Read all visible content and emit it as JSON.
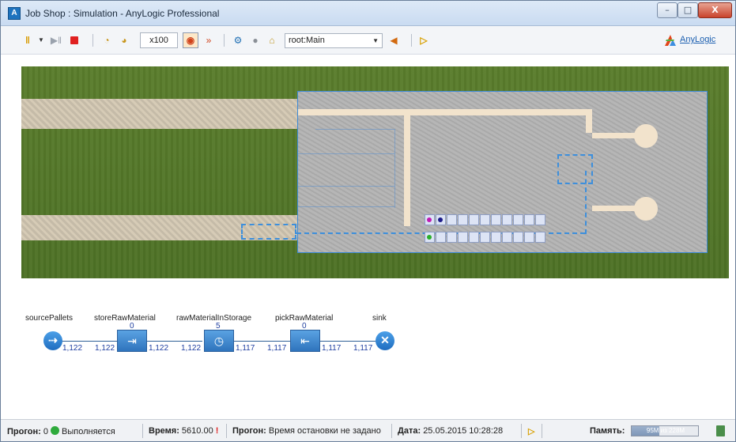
{
  "window": {
    "title": "Job Shop : Simulation - AnyLogic Professional",
    "app_icon_letter": "A",
    "controls": {
      "minimize": "–",
      "maximize": "□",
      "close": "X"
    }
  },
  "toolbar": {
    "speed": "x100",
    "navigation_select": "root:Main",
    "anylogic_link": "AnyLogic"
  },
  "flowchart": {
    "nodes": [
      {
        "name": "sourcePallets",
        "count": ""
      },
      {
        "name": "storeRawMaterial",
        "count": "0"
      },
      {
        "name": "rawMaterialInStorage",
        "count": "5"
      },
      {
        "name": "pickRawMaterial",
        "count": "0"
      },
      {
        "name": "sink",
        "count": ""
      }
    ],
    "link_counts": [
      {
        "left": "1,122",
        "right": "1,122"
      },
      {
        "left": "1,122",
        "right": "1,122"
      },
      {
        "left": "1,117",
        "right": "1,117"
      },
      {
        "left": "1,117",
        "right": "1,117"
      }
    ]
  },
  "statusbar": {
    "run_label": "Прогон:",
    "run_number": "0",
    "run_state": "Выполняется",
    "time_label": "Время:",
    "time_value": "5610.00",
    "stop_label": "Прогон:",
    "stop_value": "Время остановки не задано",
    "date_label": "Дата:",
    "date_value": "25.05.2015 10:28:28",
    "memory_label": "Память:",
    "memory_used": "95M",
    "memory_total": "из 228M",
    "memory_fraction": 0.42
  },
  "colors": {
    "accent": "#1e73be",
    "grass": "#4d7125",
    "floor": "#b0b0b0",
    "path": "#f2e3cc",
    "node": "#2f74bd"
  }
}
